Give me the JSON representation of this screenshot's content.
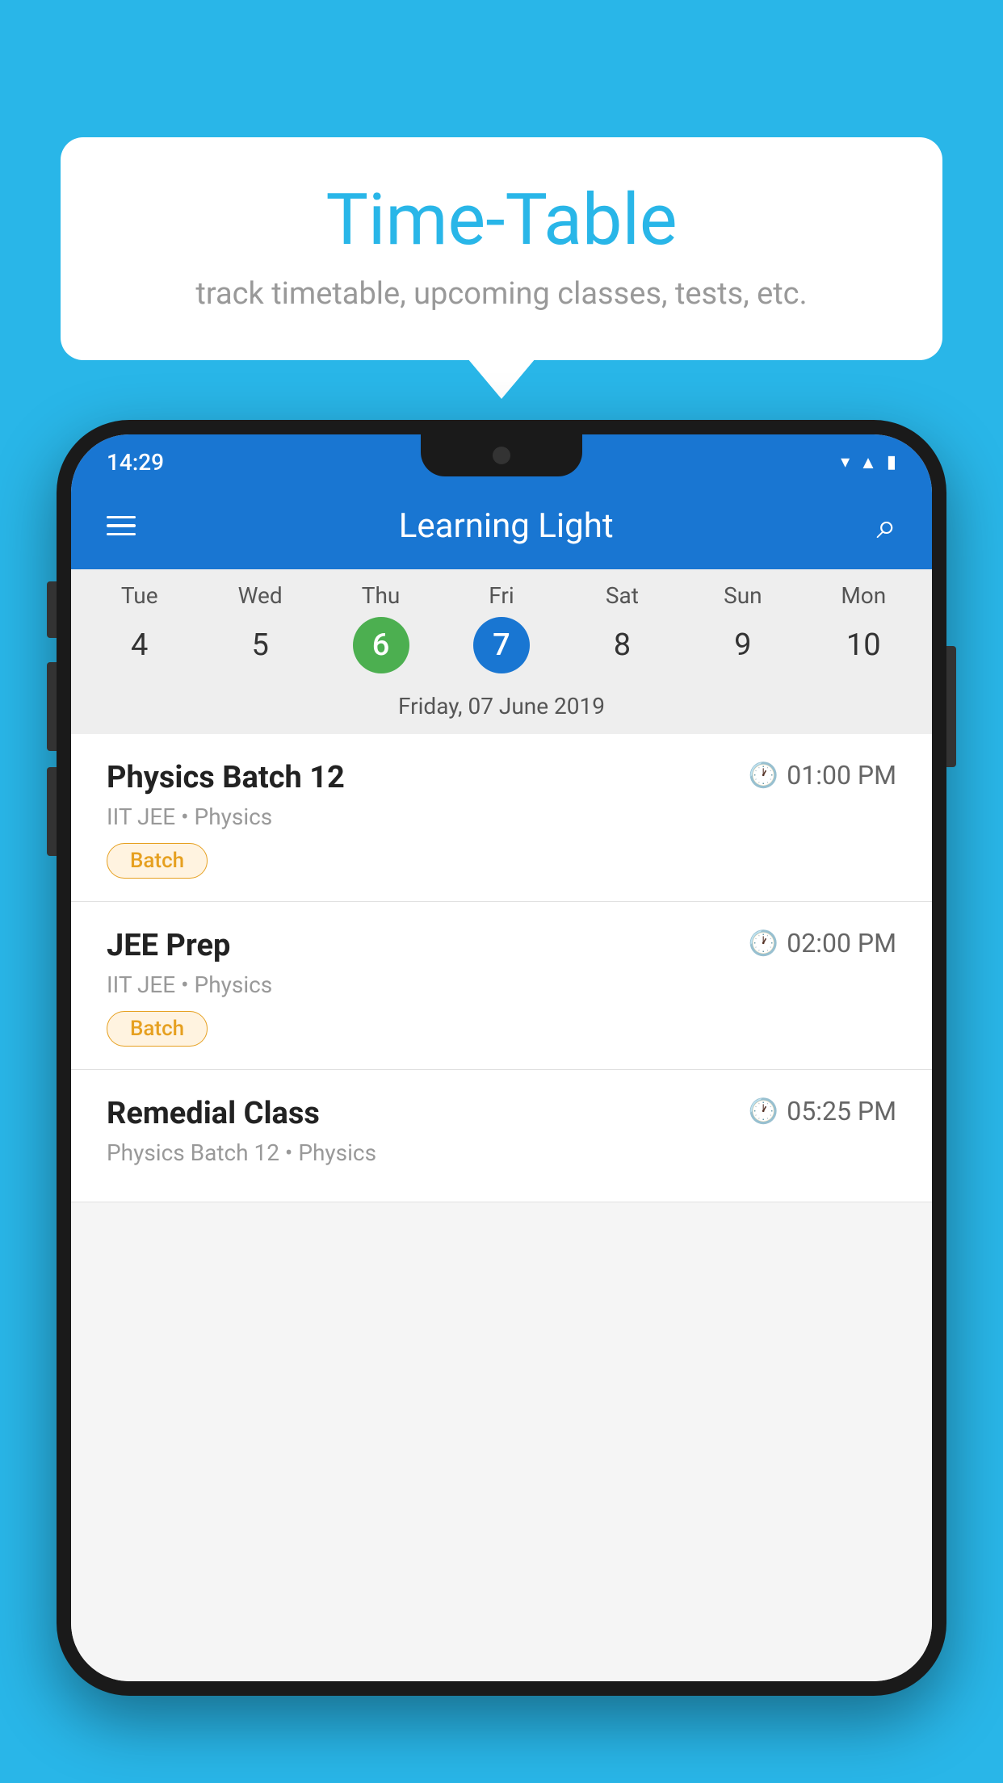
{
  "background_color": "#29b6e8",
  "tooltip": {
    "title": "Time-Table",
    "subtitle": "track timetable, upcoming classes, tests, etc."
  },
  "phone": {
    "status_bar": {
      "time": "14:29"
    },
    "app_bar": {
      "title": "Learning Light"
    },
    "calendar": {
      "days": [
        {
          "abbr": "Tue",
          "num": "4",
          "state": "normal"
        },
        {
          "abbr": "Wed",
          "num": "5",
          "state": "normal"
        },
        {
          "abbr": "Thu",
          "num": "6",
          "state": "today"
        },
        {
          "abbr": "Fri",
          "num": "7",
          "state": "selected"
        },
        {
          "abbr": "Sat",
          "num": "8",
          "state": "normal"
        },
        {
          "abbr": "Sun",
          "num": "9",
          "state": "normal"
        },
        {
          "abbr": "Mon",
          "num": "10",
          "state": "normal"
        }
      ],
      "selected_date": "Friday, 07 June 2019"
    },
    "schedule": [
      {
        "title": "Physics Batch 12",
        "time": "01:00 PM",
        "subtitle": "IIT JEE • Physics",
        "badge": "Batch"
      },
      {
        "title": "JEE Prep",
        "time": "02:00 PM",
        "subtitle": "IIT JEE • Physics",
        "badge": "Batch"
      },
      {
        "title": "Remedial Class",
        "time": "05:25 PM",
        "subtitle": "Physics Batch 12 • Physics",
        "badge": null
      }
    ]
  }
}
